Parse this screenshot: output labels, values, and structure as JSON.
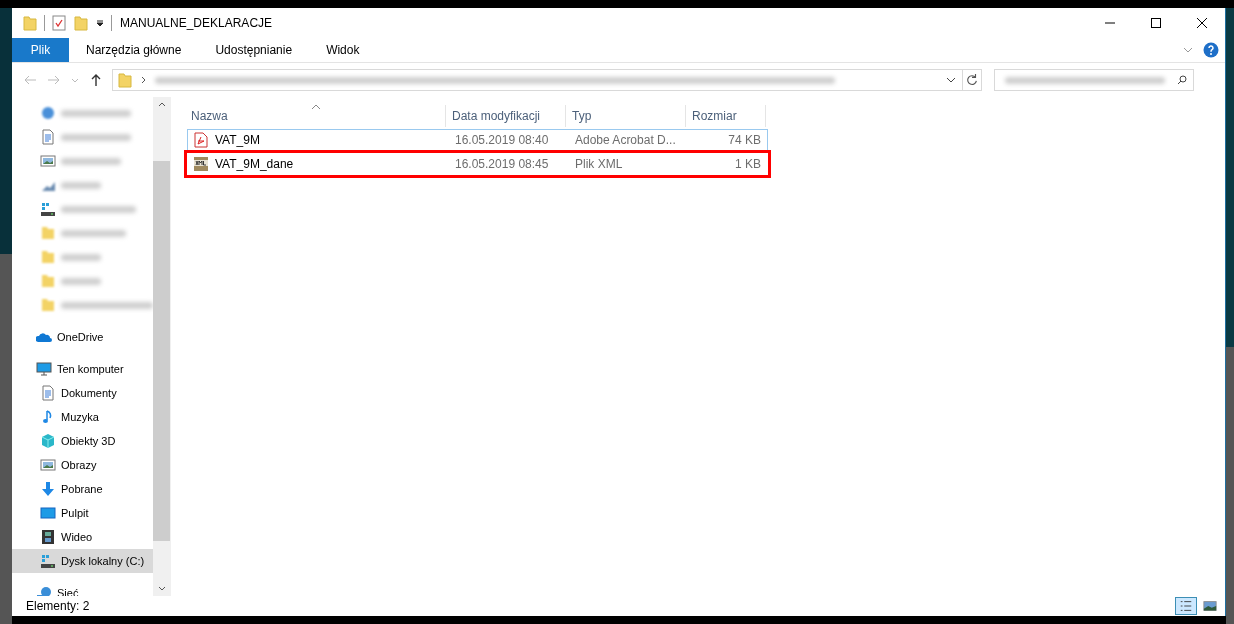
{
  "window": {
    "title": "MANUALNE_DEKLARACJE"
  },
  "ribbon_tabs": [
    {
      "label": "Plik",
      "kind": "file"
    },
    {
      "label": "Narzędzia główne",
      "kind": "tab"
    },
    {
      "label": "Udostępnianie",
      "kind": "tab"
    },
    {
      "label": "Widok",
      "kind": "tab"
    }
  ],
  "sidebar": {
    "items": [
      {
        "kind": "blurred"
      },
      {
        "kind": "blurred"
      },
      {
        "kind": "blurred"
      },
      {
        "kind": "blurred"
      },
      {
        "kind": "blurred"
      },
      {
        "kind": "blurred"
      },
      {
        "kind": "blurred"
      },
      {
        "kind": "blurred"
      },
      {
        "kind": "blurred"
      },
      {
        "kind": "node",
        "label": "OneDrive",
        "selected": false
      },
      {
        "kind": "node",
        "label": "Ten komputer",
        "selected": false,
        "children": [
          {
            "label": "Dokumenty",
            "selected": false
          },
          {
            "label": "Muzyka",
            "selected": false
          },
          {
            "label": "Obiekty 3D",
            "selected": false
          },
          {
            "label": "Obrazy",
            "selected": false
          },
          {
            "label": "Pobrane",
            "selected": false
          },
          {
            "label": "Pulpit",
            "selected": false
          },
          {
            "label": "Wideo",
            "selected": false
          },
          {
            "label": "Dysk lokalny (C:)",
            "selected": true
          }
        ]
      },
      {
        "kind": "node",
        "label": "Sieć",
        "selected": false
      }
    ]
  },
  "table": {
    "columns": [
      "Nazwa",
      "Data modyfikacji",
      "Typ",
      "Rozmiar"
    ],
    "rows": [
      {
        "kind": "pdf",
        "name": "VAT_9M",
        "date": "16.05.2019 08:40",
        "type": "Adobe Acrobat D...",
        "size": "74 KB",
        "focused": true,
        "highlighted": false
      },
      {
        "kind": "xml",
        "name": "VAT_9M_dane",
        "date": "16.05.2019 08:45",
        "type": "Plik XML",
        "size": "1 KB",
        "focused": false,
        "highlighted": true
      }
    ]
  },
  "status_bar": {
    "text": "Elementy: 2"
  }
}
